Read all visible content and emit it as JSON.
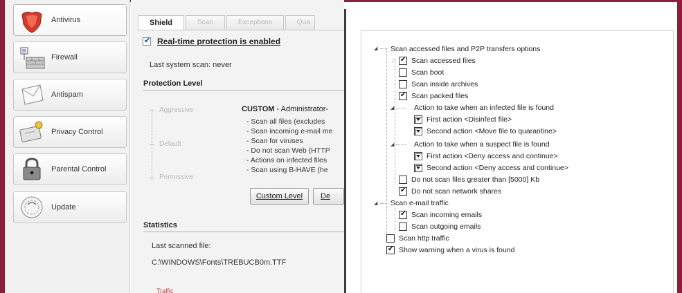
{
  "sidebar": {
    "items": [
      {
        "label": "Antivirus",
        "icon": "shield-icon"
      },
      {
        "label": "Firewall",
        "icon": "firewall-icon"
      },
      {
        "label": "Antispam",
        "icon": "envelope-icon"
      },
      {
        "label": "Privacy Control",
        "icon": "privacy-icon"
      },
      {
        "label": "Parental Control",
        "icon": "lock-icon"
      },
      {
        "label": "Update",
        "icon": "update-icon"
      }
    ]
  },
  "tabs": [
    "Shield",
    "Scan",
    "Exceptions",
    "Qua"
  ],
  "shield": {
    "realtime_label": "Real-time protection is enabled",
    "last_scan": "Last system scan: never",
    "protection_level_title": "Protection Level",
    "levels": [
      "Aggressive",
      "Default",
      "Permissive"
    ],
    "custom_title_bold": "CUSTOM",
    "custom_title_rest": " - Administrator-",
    "descriptions": [
      "- Scan all files (excludes",
      "- Scan incoming e-mail me",
      "- Scan for viruses",
      "- Do not scan Web (HTTP",
      "- Actions on infected files",
      "- Scan using B-HAVE (he"
    ],
    "custom_level_button": "Custom Level",
    "second_button": "De",
    "statistics_title": "Statistics",
    "last_scanned_label": "Last scanned file:",
    "last_scanned_value": "C:\\WINDOWS\\Fonts\\TREBUCB0m.TTF",
    "traffic_label": "Traffic"
  },
  "tree": {
    "root_label": "Scan accessed files and P2P transfers options",
    "scan_accessed": "Scan accessed files",
    "scan_boot": "Scan boot",
    "scan_archives": "Scan inside archives",
    "scan_packed": "Scan packed files",
    "infected_header": "Action to take when an infected file is found",
    "infected_first": "First action <Disinfect file>",
    "infected_second": "Second action <Move file to quarantine>",
    "suspect_header": "Action to take when a suspect file is found",
    "suspect_first": "First action <Deny access and continue>",
    "suspect_second": "Second action <Deny access and continue>",
    "size_limit": "Do not scan files greater than [5000] Kb",
    "network_shares": "Do not scan network shares",
    "email_header": "Scan e-mail traffic",
    "incoming_emails": "Scan incoming emails",
    "outgoing_emails": "Scan outgoing emails",
    "http_traffic": "Scan http traffic",
    "show_warning": "Show warning when a virus is found"
  },
  "colors": {
    "frame": "#8a1f3c",
    "antivirus_red": "#d33a2c"
  }
}
